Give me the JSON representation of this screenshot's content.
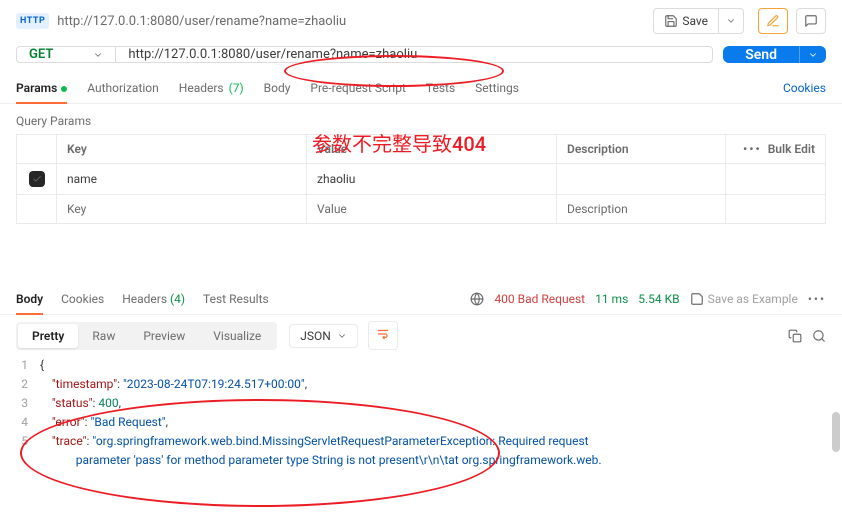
{
  "topbar": {
    "http_badge": "HTTP",
    "title": "http://127.0.0.1:8080/user/rename?name=zhaoliu",
    "save_label": "Save"
  },
  "request": {
    "method": "GET",
    "url": "http://127.0.0.1:8080/user/rename",
    "query": "?name=zhaoliu",
    "send_label": "Send"
  },
  "req_tabs": {
    "params": "Params",
    "authorization": "Authorization",
    "headers": "Headers",
    "headers_count": "(7)",
    "body": "Body",
    "prerequest": "Pre-request Script",
    "tests": "Tests",
    "settings": "Settings",
    "cookies": "Cookies"
  },
  "qp": {
    "section": "Query Params",
    "hdr_key": "Key",
    "hdr_value": "Value",
    "hdr_desc": "Description",
    "bulk_edit": "Bulk Edit",
    "rows": [
      {
        "checked": true,
        "key": "name",
        "value": "zhaoliu",
        "desc": ""
      }
    ],
    "ph_key": "Key",
    "ph_value": "Value",
    "ph_desc": "Description"
  },
  "annotation": {
    "text": "参数不完整导致404"
  },
  "resp_tabs": {
    "body": "Body",
    "cookies": "Cookies",
    "headers": "Headers",
    "headers_count": "(4)",
    "test_results": "Test Results"
  },
  "status": {
    "code": "400 Bad Request",
    "time": "11 ms",
    "size": "5.54 KB",
    "save_example": "Save as Example"
  },
  "viewbar": {
    "pretty": "Pretty",
    "raw": "Raw",
    "preview": "Preview",
    "visualize": "Visualize",
    "format": "JSON"
  },
  "json_body": {
    "timestamp_key": "\"timestamp\"",
    "timestamp_val": "\"2023-08-24T07:19:24.517+00:00\"",
    "status_key": "\"status\"",
    "status_val": "400",
    "error_key": "\"error\"",
    "error_val": "\"Bad Request\"",
    "trace_key": "\"trace\"",
    "trace_val_1": "\"org.springframework.web.bind.MissingServletRequestParameterException: Required request",
    "trace_val_2": "    parameter 'pass' for method parameter type String is not present\\r\\n\\tat org.springframework.web."
  }
}
